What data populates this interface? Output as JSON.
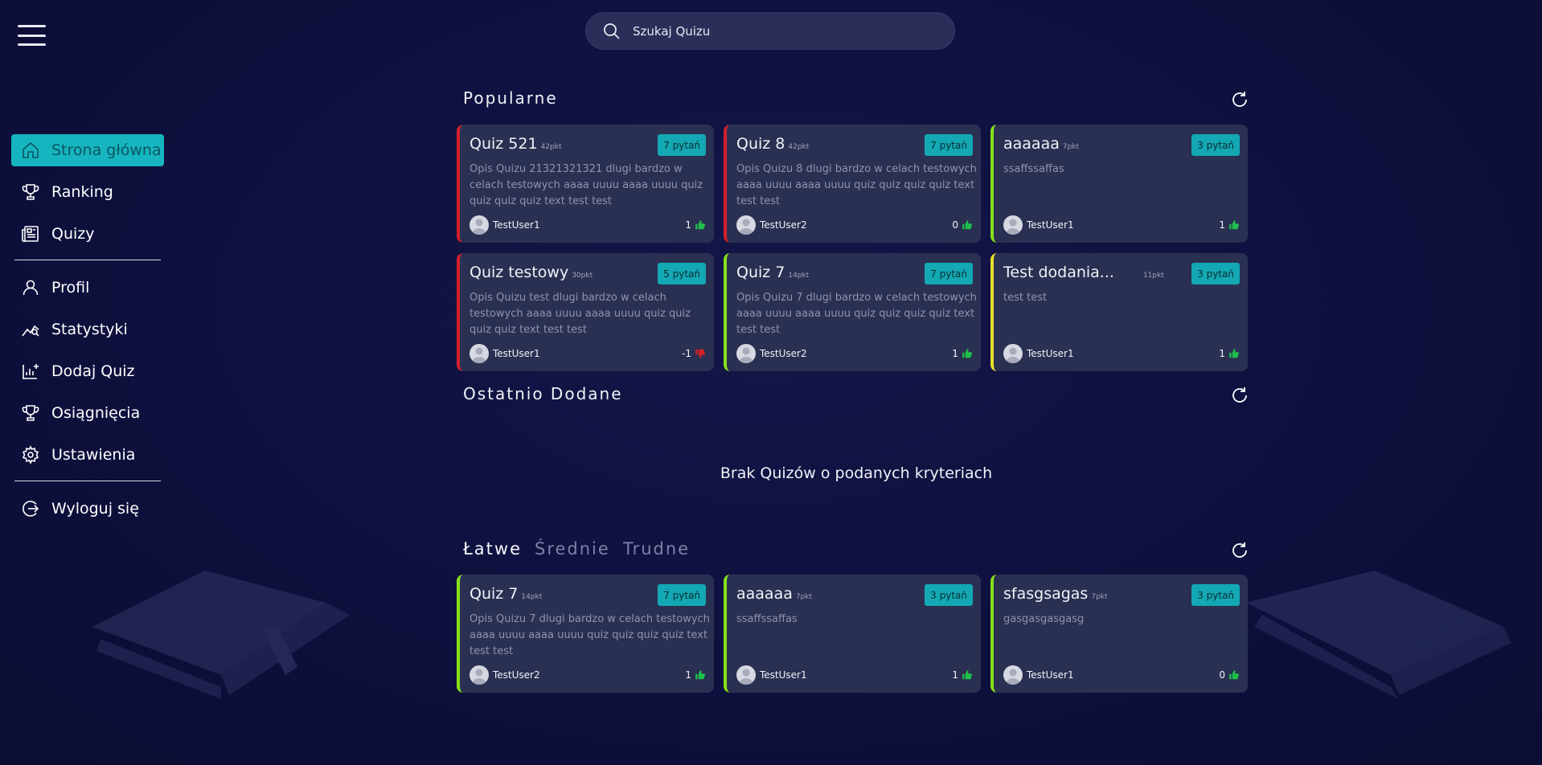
{
  "search": {
    "placeholder": "Szukaj Quizu"
  },
  "sidebar": {
    "items": [
      {
        "label": "Strona główna",
        "icon": "home-icon",
        "active": true
      },
      {
        "label": "Ranking",
        "icon": "trophy-icon"
      },
      {
        "label": "Quizy",
        "icon": "newspaper-icon"
      },
      {
        "label": "Profil",
        "icon": "user-icon"
      },
      {
        "label": "Statystyki",
        "icon": "chart-line-icon"
      },
      {
        "label": "Dodaj Quiz",
        "icon": "add-chart-icon"
      },
      {
        "label": "Osiągnięcia",
        "icon": "trophy-icon"
      },
      {
        "label": "Ustawienia",
        "icon": "gear-icon"
      },
      {
        "label": "Wyloguj się",
        "icon": "logout-icon"
      }
    ]
  },
  "colors": {
    "accent": "#16b5c0",
    "red_border": "#d0202a",
    "green_border": "#86e01a",
    "yellow_border": "#e6e029",
    "thumb_up": "#1fbf4b",
    "thumb_down": "#d0202a"
  },
  "popular": {
    "title": "Popularne",
    "cards": [
      {
        "title": "Quiz 521",
        "points": "42pkt",
        "questions": "7 pytań",
        "desc": "Opis Quizu 21321321321 dlugi bardzo w celach testowych aaaa uuuu aaaa uuuu quiz quiz quiz quiz text test test",
        "user": "TestUser1",
        "votes": "1"
      },
      {
        "title": "Quiz 8",
        "points": "42pkt",
        "questions": "7 pytań",
        "desc": "Opis Quizu 8 dlugi bardzo w celach testowych aaaa uuuu aaaa uuuu quiz quiz quiz quiz text test test",
        "user": "TestUser2",
        "votes": "0"
      },
      {
        "title": "aaaaaa",
        "points": "7pkt",
        "questions": "3 pytań",
        "desc": "ssaffssaffas",
        "user": "TestUser1",
        "votes": "1"
      },
      {
        "title": "Quiz testowy",
        "points": "30pkt",
        "questions": "5 pytań",
        "desc": "Opis Quizu test dlugi bardzo w celach testowych aaaa uuuu aaaa uuuu quiz quiz quiz quiz text test test",
        "user": "TestUser1",
        "votes": "-1"
      },
      {
        "title": "Quiz 7",
        "points": "14pkt",
        "questions": "7 pytań",
        "desc": "Opis Quizu 7 dlugi bardzo w celach testowych aaaa uuuu aaaa uuuu quiz quiz quiz quiz text test test",
        "user": "TestUser2",
        "votes": "1"
      },
      {
        "title": "Test dodania...",
        "points": "11pkt",
        "questions": "3 pytań",
        "desc": "test test",
        "user": "TestUser1",
        "votes": "1"
      }
    ]
  },
  "recent": {
    "title": "Ostatnio Dodane",
    "empty": "Brak Quizów o podanych kryteriach"
  },
  "difficulty": {
    "tabs": [
      "Łatwe",
      "Średnie",
      "Trudne"
    ],
    "cards": [
      {
        "title": "Quiz 7",
        "points": "14pkt",
        "questions": "7 pytań",
        "desc": "Opis Quizu 7 dlugi bardzo w celach testowych aaaa uuuu aaaa uuuu quiz quiz quiz quiz text test test",
        "user": "TestUser2",
        "votes": "1"
      },
      {
        "title": "aaaaaa",
        "points": "7pkt",
        "questions": "3 pytań",
        "desc": "ssaffssaffas",
        "user": "TestUser1",
        "votes": "1"
      },
      {
        "title": "sfasgsagas",
        "points": "7pkt",
        "questions": "3 pytań",
        "desc": "gasgasgasgasg",
        "user": "TestUser1",
        "votes": "0"
      }
    ]
  }
}
